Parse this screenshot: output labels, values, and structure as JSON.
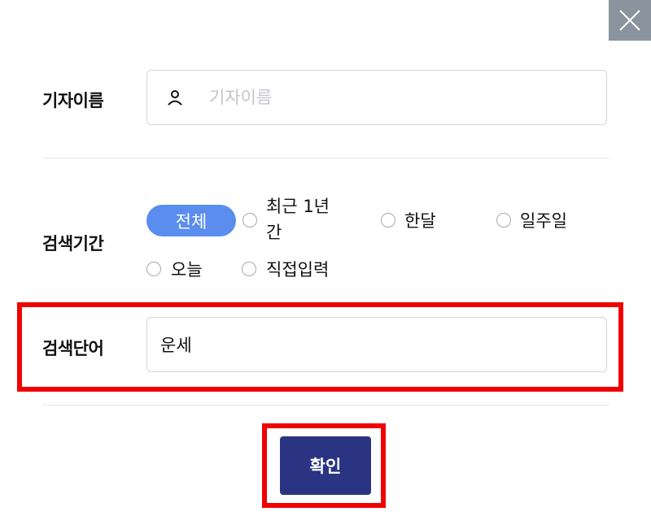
{
  "close_icon": "close-icon",
  "reporter": {
    "label": "기자이름",
    "placeholder": "기자이름",
    "icon": "person-icon"
  },
  "period": {
    "label": "검색기간",
    "selected": "전체",
    "options": [
      {
        "line1": "최근 1년",
        "line2": "간"
      },
      {
        "line1": "한달"
      },
      {
        "line1": "일주일"
      },
      {
        "line1": "오늘"
      },
      {
        "line1": "직접입력"
      }
    ]
  },
  "keyword": {
    "label": "검색단어",
    "value": "운세"
  },
  "confirm_label": "확인",
  "colors": {
    "close_bg": "#8a949e",
    "pill_bg": "#5b8def",
    "confirm_bg": "#2a3482",
    "highlight": "#f00000"
  }
}
